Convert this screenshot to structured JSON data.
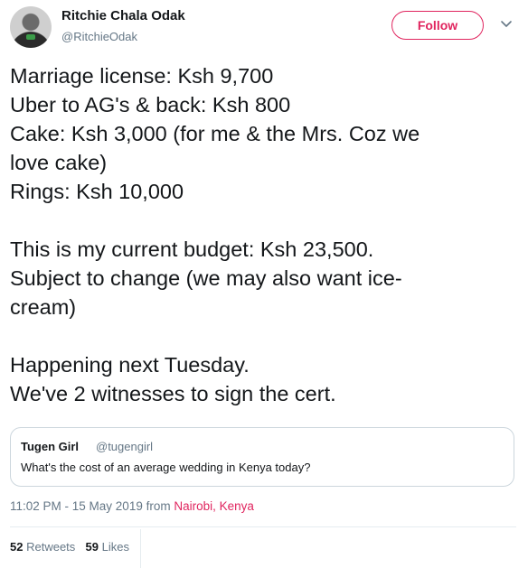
{
  "author": {
    "name": "Ritchie Chala Odak",
    "handle": "@RitchieOdak",
    "follow_label": "Follow"
  },
  "tweet": {
    "lines": [
      "Marriage license: Ksh 9,700",
      "Uber to AG's & back: Ksh 800",
      "Cake: Ksh 3,000 (for me & the Mrs. Coz we",
      "love cake)",
      "Rings: Ksh 10,000",
      "",
      "This is my current budget: Ksh 23,500.",
      "Subject to change (we may also want ice-",
      "cream)",
      "",
      "Happening next Tuesday.",
      "We've 2 witnesses to sign the cert."
    ]
  },
  "quote": {
    "name": "Tugen Girl",
    "handle": "@tugengirl",
    "text": "What's the cost of an average wedding in Kenya today?"
  },
  "meta": {
    "time": "11:02 PM - 15 May 2019 from ",
    "location": "Nairobi, Kenya"
  },
  "stats": {
    "retweets_count": "52",
    "retweets_label": "Retweets",
    "likes_count": "59",
    "likes_label": "Likes"
  },
  "colors": {
    "accent": "#e0245e",
    "muted": "#657786",
    "text": "#14171a",
    "border": "#ccd6dd"
  },
  "icons": {
    "menu": "chevron-down-icon"
  }
}
